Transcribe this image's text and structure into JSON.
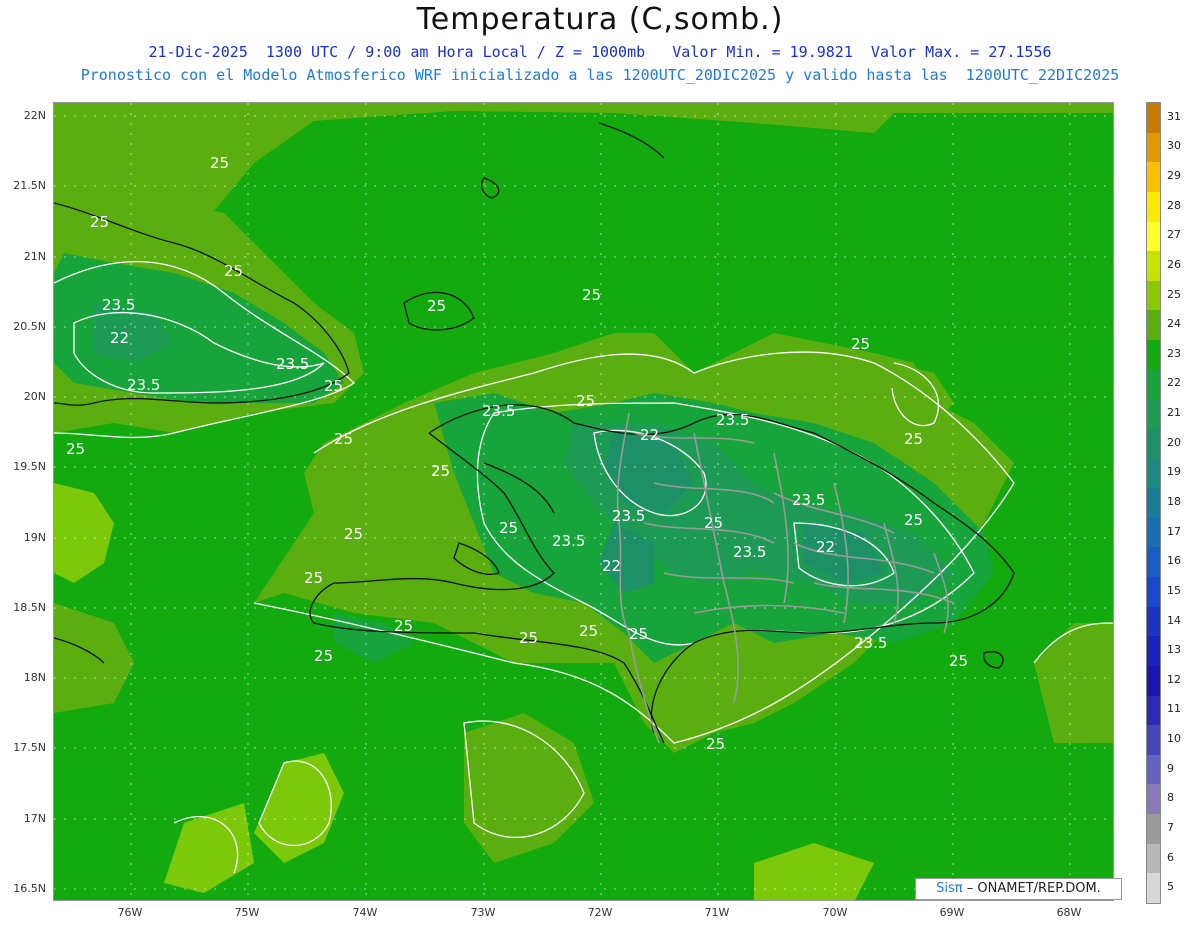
{
  "header": {
    "title": "Temperatura (C,somb.)",
    "line1": "21-Dic-2025  1300 UTC / 9:00 am Hora Local / Z = 1000mb   Valor Min. = 19.9821  Valor Max. = 27.1556",
    "line2": "Pronostico con el Modelo Atmosferico WRF inicializado a las 1200UTC_20DIC2025 y valido hasta las  1200UTC_22DIC2025"
  },
  "axes": {
    "lat_labels": [
      "22N",
      "21.5N",
      "21N",
      "20.5N",
      "20N",
      "19.5N",
      "19N",
      "18.5N",
      "18N",
      "17.5N",
      "17N",
      "16.5N"
    ],
    "lon_labels": [
      "76W",
      "75W",
      "74W",
      "73W",
      "72W",
      "71W",
      "70W",
      "69W",
      "68W"
    ]
  },
  "contour_labels": [
    "25",
    "25",
    "25",
    "25",
    "25",
    "25",
    "25",
    "25",
    "25",
    "25",
    "25",
    "25",
    "25",
    "25",
    "25",
    "25",
    "25",
    "25",
    "25",
    "25",
    "25",
    "25",
    "25",
    "25",
    "23.5",
    "23.5",
    "23.5",
    "23.5",
    "23.5",
    "23.5",
    "23.5",
    "23.5",
    "23.5",
    "23.5",
    "22",
    "22",
    "22",
    "22"
  ],
  "colorbar": {
    "labels": [
      "31",
      "30",
      "29",
      "28",
      "27",
      "26",
      "25",
      "24",
      "23",
      "22",
      "21",
      "20",
      "19",
      "18",
      "17",
      "16",
      "15",
      "14",
      "13",
      "12",
      "11",
      "10",
      "9",
      "8",
      "7",
      "6",
      "5"
    ],
    "colors": [
      "#c47c00",
      "#e39800",
      "#f8c000",
      "#fde800",
      "#ffff30",
      "#c8e000",
      "#8cc800",
      "#5aae10",
      "#12aa0e",
      "#17a43a",
      "#1d9b55",
      "#1e9068",
      "#1a8a80",
      "#1a7d96",
      "#1b6fb0",
      "#1a5cc6",
      "#1a48cc",
      "#1a34c4",
      "#1a22bc",
      "#1a14b0",
      "#2a2ab4",
      "#4646b8",
      "#6464c0",
      "#8a7ab8",
      "#9a9a9a",
      "#b8b8b8",
      "#d8d8d8"
    ]
  },
  "credit": {
    "brand": "Sisπ",
    "text": "– ONAMET/REP.DOM."
  },
  "colors": {
    "sea_base": "#12aa0e",
    "warm_band": "#5aae10",
    "warmer": "#7cc80a",
    "cool_land": "#17a43a",
    "cooler_land": "#1d9b55",
    "coldest": "#1e9068",
    "contour": "#ffffff",
    "coast": "#111111",
    "border": "#9a9a9a",
    "title_blue": "#1a2fd9",
    "subtitle_blue": "#1e7be6"
  }
}
